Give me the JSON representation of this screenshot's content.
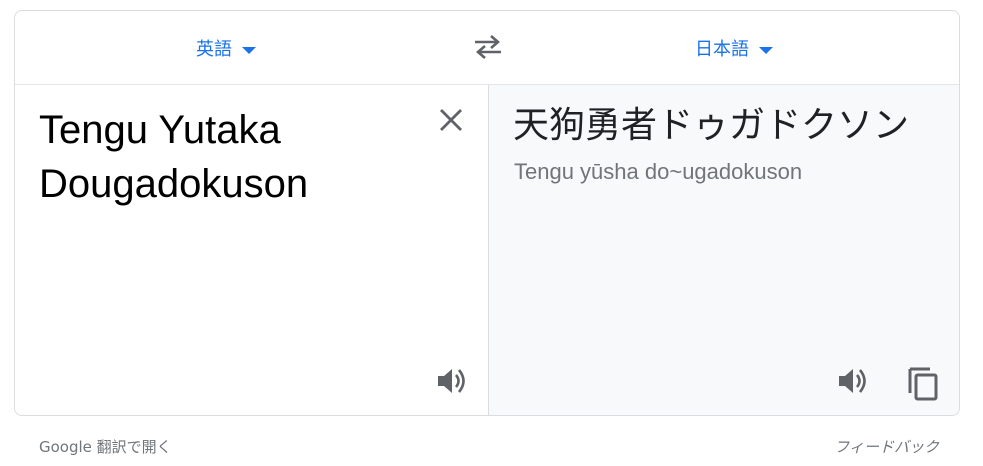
{
  "languages": {
    "source": "英語",
    "target": "日本語"
  },
  "source": {
    "text": "Tengu Yutaka Dougadokuson"
  },
  "target": {
    "text": "天狗勇者ドゥガドクソン",
    "transliteration": "Tengu yūsha do~ugadokuson"
  },
  "footer": {
    "open_in_translate": "Google 翻訳で開く",
    "feedback": "フィードバック"
  },
  "icons": {
    "swap": "swap-arrows-icon",
    "clear": "close-icon",
    "speaker": "speaker-icon",
    "copy": "copy-icon"
  },
  "colors": {
    "accent": "#1a73e8",
    "icon": "#5f6368",
    "target_pane_bg": "#f8f9fa"
  }
}
